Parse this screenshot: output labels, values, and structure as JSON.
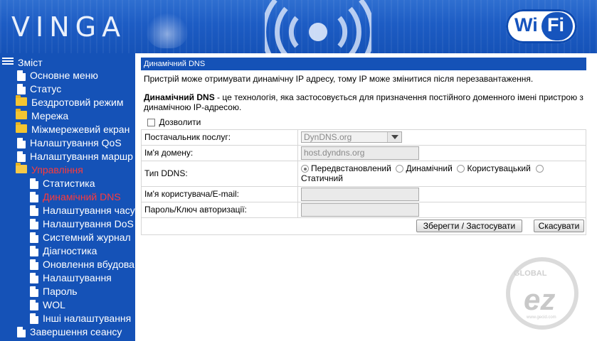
{
  "header": {
    "brand": "VINGA",
    "wifi_logo_wi": "Wi",
    "wifi_logo_fi": "Fi"
  },
  "sidebar": {
    "root_label": "Зміст",
    "items": [
      {
        "label": "Основне меню",
        "icon": "document-icon"
      },
      {
        "label": "Статус",
        "icon": "document-icon"
      },
      {
        "label": "Бездротовий режим",
        "icon": "folder-icon"
      },
      {
        "label": "Мережа",
        "icon": "folder-icon"
      },
      {
        "label": "Міжмережевий екран",
        "icon": "folder-icon"
      },
      {
        "label": "Налаштування QoS",
        "icon": "document-icon"
      },
      {
        "label": "Налаштування маршр",
        "icon": "document-icon"
      },
      {
        "label": "Управління",
        "icon": "folder-open-icon"
      },
      {
        "label": "Статистика",
        "icon": "document-icon"
      },
      {
        "label": "Динамічний DNS",
        "icon": "document-icon"
      },
      {
        "label": "Налаштування часу",
        "icon": "document-icon"
      },
      {
        "label": "Налаштування DoS",
        "icon": "document-icon"
      },
      {
        "label": "Системний журнал",
        "icon": "document-icon"
      },
      {
        "label": "Діагностика",
        "icon": "document-icon"
      },
      {
        "label": "Оновлення вбудова",
        "icon": "document-icon"
      },
      {
        "label": "Налаштування",
        "icon": "document-icon"
      },
      {
        "label": "Пароль",
        "icon": "document-icon"
      },
      {
        "label": "WOL",
        "icon": "document-icon"
      },
      {
        "label": "Інші налаштування",
        "icon": "document-icon"
      },
      {
        "label": "Завершення сеансу",
        "icon": "document-icon"
      }
    ],
    "active_color": "#ff3a3a",
    "background": "#1552b7"
  },
  "panel": {
    "title": "Динамічний DNS",
    "desc_line": "Пристрій може отримувати динамічну IP адресу, тому IP може змінитися після перезавантаження.",
    "desc_term": "Динамічний DNS",
    "desc_rest": " - це технологія, яка застосовується для призначення постійного доменного імені пристрою з динамічною IP-адресою."
  },
  "form": {
    "allow_label": "Дозволити",
    "allow_checked": false,
    "provider_label": "Постачальник послуг:",
    "provider_value": "DynDNS.org",
    "domain_label": "Ім'я домену:",
    "domain_value": "host.dyndns.org",
    "ddns_type_label": "Тип DDNS:",
    "ddns_options": [
      "Передвстановлений",
      "Динамічний",
      "Користувацький",
      "Статичний"
    ],
    "ddns_selected": "Передвстановлений",
    "user_label": "Ім'я користувача/E-mail:",
    "user_value": "",
    "password_label": "Пароль/Ключ авторизації:",
    "password_value": ""
  },
  "buttons": {
    "save_label": "Зберегти / Застосувати",
    "cancel_label": "Скасувати"
  },
  "watermark": {
    "text_global": "GLOBAL",
    "text_ez": "ez",
    "text_url": "www.gecid.com"
  }
}
